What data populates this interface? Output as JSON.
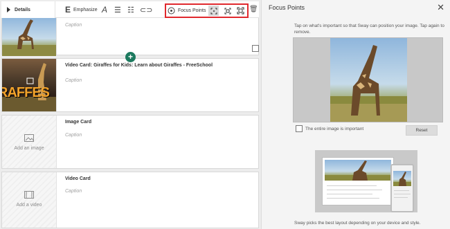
{
  "toolbar": {
    "details_label": "Details",
    "emphasize_label": "Emphasize",
    "focus_points_label": "Focus Points"
  },
  "cards": [
    {
      "title": "",
      "caption": "Caption"
    },
    {
      "title": "Video Card: Giraffes for Kids: Learn about Giraffes - FreeSchool",
      "caption": "Caption",
      "thumb_text": "RAFFES"
    },
    {
      "title": "Image Card",
      "caption": "Caption",
      "thumb_label": "Add an image"
    },
    {
      "title": "Video Card",
      "caption": "Caption",
      "thumb_label": "Add a video"
    }
  ],
  "panel": {
    "title": "Focus Points",
    "hint": "Tap on what's important so that Sway can position your image. Tap again to remove.",
    "entire_image_label": "The entire image is important",
    "reset_label": "Reset",
    "footer": "Sway picks the best layout depending on your device and style."
  },
  "colors": {
    "accent_green": "#1d7a5f",
    "highlight_red": "#e0282d"
  }
}
